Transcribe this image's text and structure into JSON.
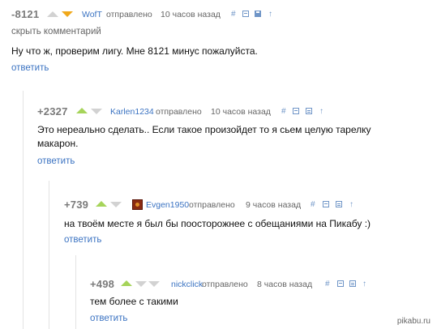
{
  "colors": {
    "link": "#3b73c2",
    "upvote": "#a6d45a",
    "downvote": "#f0a81a",
    "muted": "#d2d2d2"
  },
  "comments": [
    {
      "score": "-8121",
      "author": "WofT",
      "posted_label": "отправлено",
      "time": "10 часов назад",
      "hide_label": "скрыть комментарий",
      "text": "Ну что ж, проверим лигу. Мне 8121 минус пожалуйста.",
      "reply_label": "ответить"
    },
    {
      "score": "+2327",
      "author": "Karlen1234",
      "posted_label": "отправлено",
      "time": "10 часов назад",
      "text_line1": "Это нереально сделать.. Если такое произойдет то я сьем целую тарелку",
      "text_line2": "макарон.",
      "reply_label": "ответить"
    },
    {
      "score": "+739",
      "author": "Evgen1950",
      "posted_label": "отправлено",
      "time": "9 часов назад",
      "text": "на твоём месте я был бы поосторожнее с обещаниями на Пикабу :)",
      "reply_label": "ответить"
    },
    {
      "score": "+498",
      "author": "nickclick",
      "posted_label": "отправлено",
      "time": "8 часов назад",
      "text": "тем более с такими",
      "reply_label": "ответить"
    }
  ],
  "icons": {
    "hash": "#",
    "up": "↑"
  },
  "watermark": "pikabu.ru"
}
